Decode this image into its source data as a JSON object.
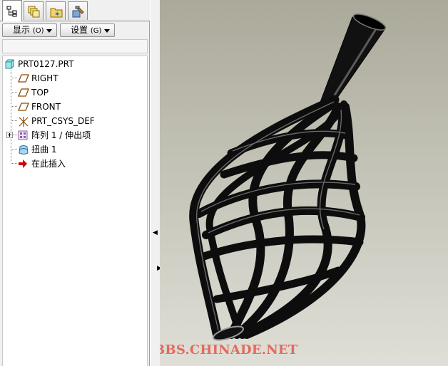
{
  "tabs": [
    {
      "icon": "model-tree-icon"
    },
    {
      "icon": "layers-icon"
    },
    {
      "icon": "folder-star-icon"
    },
    {
      "icon": "tools-icon"
    }
  ],
  "toolbar": {
    "show_label": "显示",
    "show_mnemonic": "(O)",
    "settings_label": "设置",
    "settings_mnemonic": "(G)"
  },
  "tree": {
    "root": {
      "label": "PRT0127.PRT",
      "icon": "part-icon"
    },
    "items": [
      {
        "label": "RIGHT",
        "icon": "datum-plane-icon"
      },
      {
        "label": "TOP",
        "icon": "datum-plane-icon"
      },
      {
        "label": "FRONT",
        "icon": "datum-plane-icon"
      },
      {
        "label": "PRT_CSYS_DEF",
        "icon": "coordinate-system-icon"
      },
      {
        "label": "阵列 1 / 伸出项",
        "icon": "pattern-icon"
      },
      {
        "label": "扭曲 1",
        "icon": "warp-icon"
      },
      {
        "label": "在此插入",
        "icon": "insert-here-arrow-icon"
      }
    ]
  },
  "watermark": "BBS.CHINADE.NET",
  "colors": {
    "model": "#111111",
    "viewport_top": "#aaa99a",
    "viewport_bottom": "#dfdfd7",
    "watermark": "#e36a5e",
    "insert_arrow": "#d40000"
  }
}
